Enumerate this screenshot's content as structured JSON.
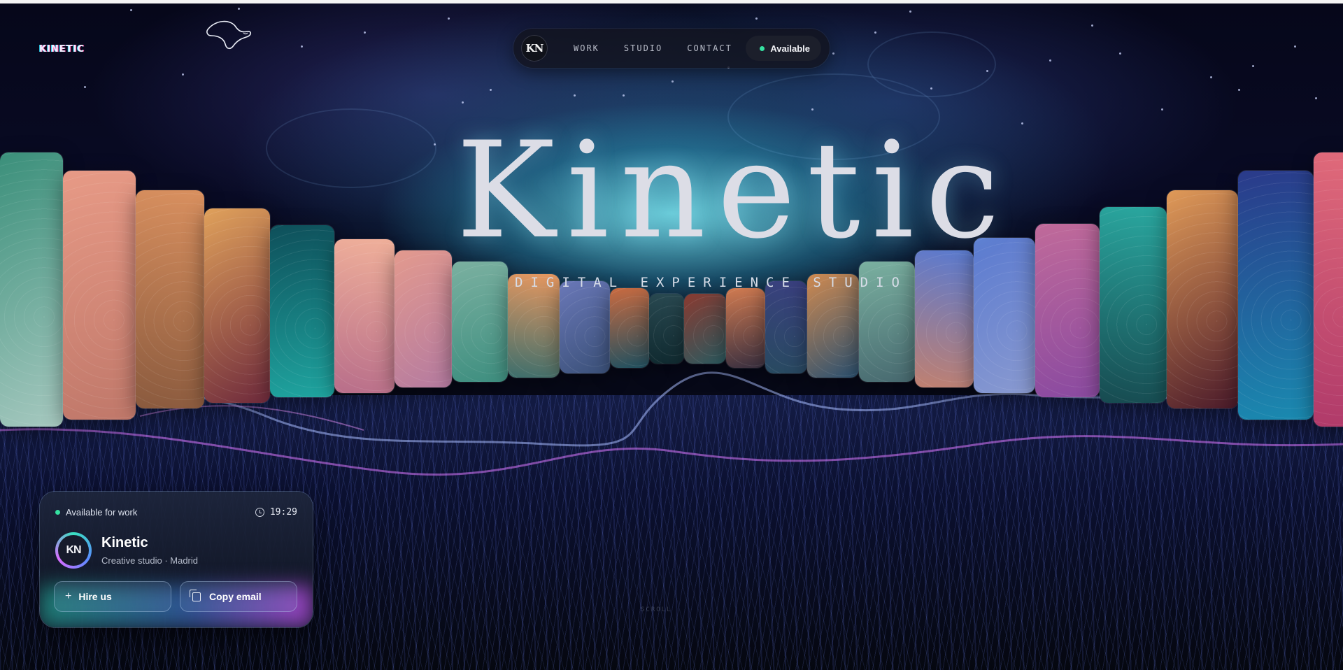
{
  "brand": {
    "logo_text": "KINETIC"
  },
  "nav": {
    "monogram": "KN",
    "links": [
      "WORK",
      "STUDIO",
      "CONTACT"
    ],
    "status": "Available"
  },
  "hero": {
    "title": "Kinetic",
    "subtitle": "DIGITAL EXPERIENCE STUDIO",
    "scroll_hint": "SCROLL"
  },
  "profile_card": {
    "availability": "Available for work",
    "time": "19:29",
    "avatar_initials": "KN",
    "name": "Kinetic",
    "description": "Creative studio · Madrid",
    "hire_label": "Hire us",
    "copy_label": "Copy email"
  },
  "colors": {
    "status_green": "#35e0a0",
    "accent_teal": "#38e0c0",
    "accent_violet": "#d86cff",
    "background": "#04050b"
  },
  "icons": [
    "monogram-icon",
    "status-dot-icon",
    "clock-icon",
    "plus-icon",
    "copy-icon",
    "creature-logo-icon"
  ]
}
